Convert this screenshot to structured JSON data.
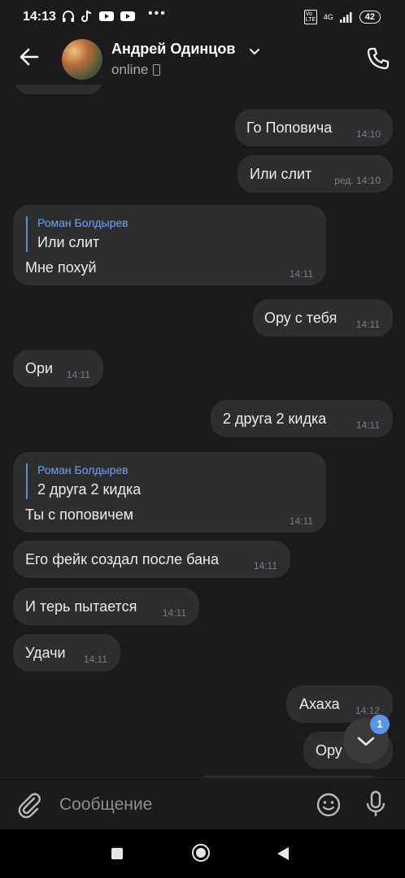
{
  "status_bar": {
    "time": "14:13",
    "network": "4G",
    "volte": "Vo LTE",
    "battery": "42"
  },
  "header": {
    "contact_name": "Андрей Одинцов",
    "status": "online"
  },
  "messages": [
    {
      "side": "out",
      "text": "Го Поповича",
      "time": "14:10"
    },
    {
      "side": "out",
      "text": "Или слит",
      "time": "ред. 14:10"
    },
    {
      "side": "in",
      "reply_author": "Роман Болдырев",
      "reply_text": "Или слит",
      "text": "Мне похуй",
      "time": "14:11"
    },
    {
      "side": "out",
      "text": "Ору с тебя",
      "time": "14:11"
    },
    {
      "side": "in",
      "text": "Ори",
      "time": "14:11"
    },
    {
      "side": "out",
      "text": "2 друга 2 кидка",
      "time": "14:11"
    },
    {
      "side": "in",
      "reply_author": "Роман Болдырев",
      "reply_text": "2 друга 2 кидка",
      "text": "Ты с поповичем",
      "time": "14:11"
    },
    {
      "side": "in",
      "text": "Его фейк создал после бана",
      "time": "14:11"
    },
    {
      "side": "in",
      "text": "И терь пытается",
      "time": "14:11"
    },
    {
      "side": "in",
      "text": "Удачи",
      "time": "14:11"
    },
    {
      "side": "out",
      "text": "Ахаха",
      "time": "14:12"
    },
    {
      "side": "out",
      "text": "Ору",
      "time": ""
    }
  ],
  "scroll_badge": "1",
  "input": {
    "placeholder": "Сообщение"
  },
  "icons": {
    "back": "back-arrow-icon",
    "call": "phone-call-icon",
    "attach": "paperclip-icon",
    "emoji": "smiley-icon",
    "mic": "microphone-icon",
    "scroll": "chevron-down-icon"
  }
}
